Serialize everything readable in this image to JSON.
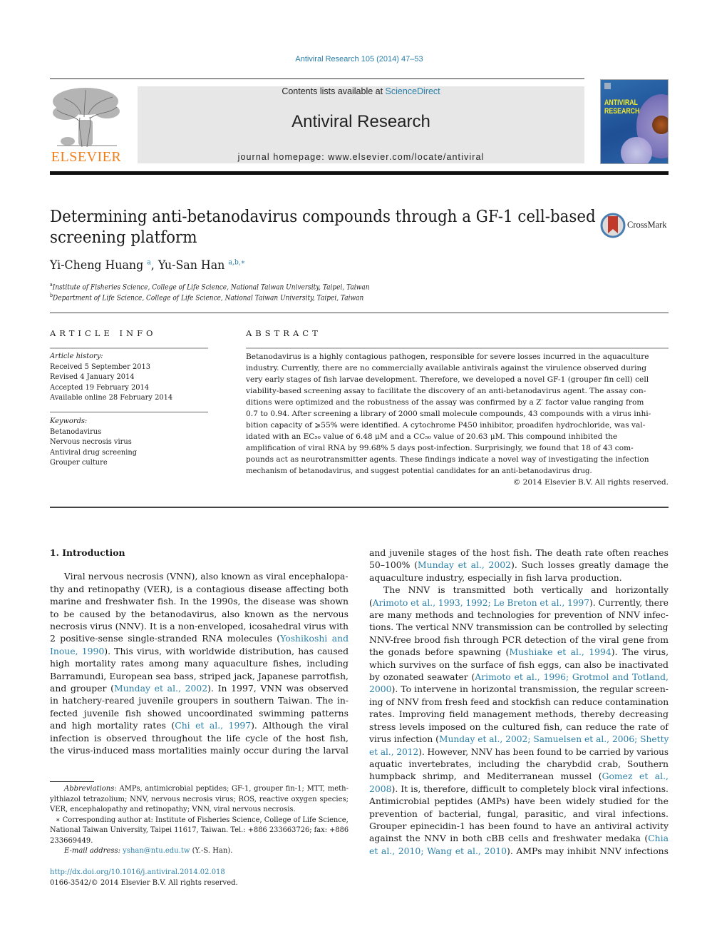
{
  "journal_ref": "Antiviral Research 105 (2014) 47–53",
  "header": {
    "contents_prefix": "Contents lists available at ",
    "contents_link": "ScienceDirect",
    "journal_title": "Antiviral Research",
    "homepage_prefix": "journal homepage: ",
    "homepage_url": "www.elsevier.com/locate/antiviral",
    "publisher_logo_text": "ELSEVIER",
    "cover_title_line1": "ANTIVIRAL",
    "cover_title_line2": "RESEARCH",
    "crossmark_label": "CrossMark"
  },
  "article": {
    "title_line1": "Determining anti-betanodavirus compounds through a GF-1 cell-based",
    "title_line2": "screening platform",
    "authors": [
      {
        "name": "Yi-Cheng Huang",
        "sup": "a"
      },
      {
        "name": "Yu-San Han",
        "sup": "a,b,∗"
      }
    ],
    "author_sep": ", ",
    "affiliations": [
      {
        "mark": "a",
        "text": "Institute of Fisheries Science, College of Life Science, National Taiwan University, Taipei, Taiwan"
      },
      {
        "mark": "b",
        "text": "Department of Life Science, College of Life Science, National Taiwan University, Taipei, Taiwan"
      }
    ]
  },
  "article_info": {
    "heading": "ARTICLE INFO",
    "history_label": "Article history:",
    "history": [
      "Received 5 September 2013",
      "Revised 4 January 2014",
      "Accepted 19 February 2014",
      "Available online 28 February 2014"
    ],
    "keywords_label": "Keywords:",
    "keywords": [
      "Betanodavirus",
      "Nervous necrosis virus",
      "Antiviral drug screening",
      "Grouper culture"
    ]
  },
  "abstract": {
    "heading": "ABSTRACT",
    "lines": [
      "Betanodavirus is a highly contagious pathogen, responsible for severe losses incurred in the aquaculture",
      "industry. Currently, there are no commercially available antivirals against the virulence observed during",
      "very early stages of fish larvae development. Therefore, we developed a novel GF-1 (grouper fin cell) cell",
      "viability-based screening assay to facilitate the discovery of an anti-betanodavirus agent. The assay con-",
      "ditions were optimized and the robustness of the assay was confirmed by a Z′ factor value ranging from",
      "0.7 to 0.94. After screening a library of 2000 small molecule compounds, 43 compounds with a virus inhi-",
      "bition capacity of ⩾55% were identified. A cytochrome P450 inhibitor, proadifen hydrochloride, was val-",
      "idated with an EC₅₀ value of 6.48 μM and a CC₅₀ value of 20.63 μM. This compound inhibited the",
      "amplification of viral RNA by 99.68% 5 days post-infection. Surprisingly, we found that 18 of 43 com-",
      "pounds act as neurotransmitter agents. These findings indicate a novel way of investigating the infection",
      "mechanism of betanodavirus, and suggest potential candidates for an anti-betanodavirus drug."
    ],
    "copyright": "© 2014 Elsevier B.V. All rights reserved."
  },
  "body": {
    "intro_heading": "1. Introduction",
    "left_column": [
      [
        {
          "t": "Viral nervous necrosis (VNN), also known as viral encephalopa-"
        }
      ],
      [
        {
          "t": "thy and retinopathy (VER), is a contagious disease affecting both"
        }
      ],
      [
        {
          "t": "marine and freshwater fish. In the 1990s, the disease was shown"
        }
      ],
      [
        {
          "t": "to be caused by the betanodavirus, also known as the nervous"
        }
      ],
      [
        {
          "t": "necrosis virus (NNV). It is a non-enveloped, icosahedral virus with"
        }
      ],
      [
        {
          "t": "2 positive-sense single-stranded RNA molecules ("
        },
        {
          "t": "Yoshikoshi and",
          "c": 1
        }
      ],
      [
        {
          "t": "Inoue, 1990",
          "c": 1
        },
        {
          "t": "). This virus, with worldwide distribution, has caused"
        }
      ],
      [
        {
          "t": "high mortality rates among many aquaculture fishes, including"
        }
      ],
      [
        {
          "t": "Barramundi, European sea bass, striped jack, Japanese parrotfish,"
        }
      ],
      [
        {
          "t": "and grouper ("
        },
        {
          "t": "Munday et al., 2002",
          "c": 1
        },
        {
          "t": "). In 1997, VNN was observed"
        }
      ],
      [
        {
          "t": "in hatchery-reared juvenile groupers in southern Taiwan. The in-"
        }
      ],
      [
        {
          "t": "fected juvenile fish showed uncoordinated swimming patterns"
        }
      ],
      [
        {
          "t": "and high mortality rates ("
        },
        {
          "t": "Chi et al., 1997",
          "c": 1
        },
        {
          "t": "). Although the viral"
        }
      ],
      [
        {
          "t": "infection is observed throughout the life cycle of the host fish,"
        }
      ],
      [
        {
          "t": "the virus-induced mass mortalities mainly occur during the larval"
        }
      ]
    ],
    "right_column": [
      [
        {
          "t": "and juvenile stages of the host fish. The death rate often reaches"
        }
      ],
      [
        {
          "t": "50–100% ("
        },
        {
          "t": "Munday et al., 2002",
          "c": 1
        },
        {
          "t": "). Such losses greatly damage the"
        }
      ],
      [
        {
          "t": "aquaculture industry, especially in fish larva production."
        }
      ],
      [
        {
          "t": "The NNV is transmitted both vertically and horizontally"
        }
      ],
      [
        {
          "t": "("
        },
        {
          "t": "Arimoto et al., 1993, 1992; Le Breton et al., 1997",
          "c": 1
        },
        {
          "t": "). Currently, there"
        }
      ],
      [
        {
          "t": "are many methods and technologies for prevention of NNV infec-"
        }
      ],
      [
        {
          "t": "tions. The vertical NNV transmission can be controlled by selecting"
        }
      ],
      [
        {
          "t": "NNV-free brood fish through PCR detection of the viral gene from"
        }
      ],
      [
        {
          "t": "the gonads before spawning ("
        },
        {
          "t": "Mushiake et al., 1994",
          "c": 1
        },
        {
          "t": "). The virus,"
        }
      ],
      [
        {
          "t": "which survives on the surface of fish eggs, can also be inactivated"
        }
      ],
      [
        {
          "t": "by ozonated seawater ("
        },
        {
          "t": "Arimoto et al., 1996; Grotmol and Totland,",
          "c": 1
        }
      ],
      [
        {
          "t": "2000",
          "c": 1
        },
        {
          "t": "). To intervene in horizontal transmission, the regular screen-"
        }
      ],
      [
        {
          "t": "ing of NNV from fresh feed and stockfish can reduce contamination"
        }
      ],
      [
        {
          "t": "rates. Improving field management methods, thereby decreasing"
        }
      ],
      [
        {
          "t": "stress levels imposed on the cultured fish, can reduce the rate of"
        }
      ],
      [
        {
          "t": "virus infection ("
        },
        {
          "t": "Munday et al., 2002; Samuelsen et al., 2006; Shetty",
          "c": 1
        }
      ],
      [
        {
          "t": "et al., 2012",
          "c": 1
        },
        {
          "t": "). However, NNV has been found to be carried by various"
        }
      ],
      [
        {
          "t": "aquatic invertebrates, including the charybdid crab, Southern"
        }
      ],
      [
        {
          "t": "humpback shrimp, and Mediterranean mussel ("
        },
        {
          "t": "Gomez et al.,",
          "c": 1
        }
      ],
      [
        {
          "t": "2008",
          "c": 1
        },
        {
          "t": "). It is, therefore, difficult to completely block viral infections."
        }
      ],
      [
        {
          "t": "Antimicrobial peptides (AMPs) have been widely studied for the"
        }
      ],
      [
        {
          "t": "prevention of bacterial, fungal, parasitic, and viral infections."
        }
      ],
      [
        {
          "t": "Grouper epinecidin-1 has been found to have an antiviral activity"
        }
      ],
      [
        {
          "t": "against the NNV in both cBB cells and freshwater medaka ("
        },
        {
          "t": "Chia",
          "c": 1
        }
      ],
      [
        {
          "t": "et al., 2010; Wang et al., 2010",
          "c": 1
        },
        {
          "t": "). AMPs may inhibit NNV infections"
        }
      ]
    ]
  },
  "footnotes": {
    "abbrev_label": "Abbreviations:",
    "abbrev_lines": [
      " AMPs, antimicrobial peptides; GF-1, grouper fin-1; MTT, meth-",
      "ylthiazol tetrazolium; NNV, nervous necrosis virus; ROS, reactive oxygen species;",
      "VER, encephalopathy and retinopathy; VNN, viral nervous necrosis."
    ],
    "corresponding_lines": [
      "∗ Corresponding author at: Institute of Fisheries Science, College of Life Science,",
      "National Taiwan University, Taipei 11617, Taiwan. Tel.: +886 233663726; fax: +886",
      "233669449."
    ],
    "email_label": "E-mail address:",
    "email": "yshan@ntu.edu.tw",
    "email_suffix": " (Y.-S. Han)."
  },
  "doi": "http://dx.doi.org/10.1016/j.antiviral.2014.02.018",
  "issn_line": "0166-3542/© 2014 Elsevier B.V. All rights reserved.",
  "colors": {
    "link": "#2a7fa8",
    "elsevier_orange": "#f07f1c",
    "header_band": "#e7e7e7"
  }
}
